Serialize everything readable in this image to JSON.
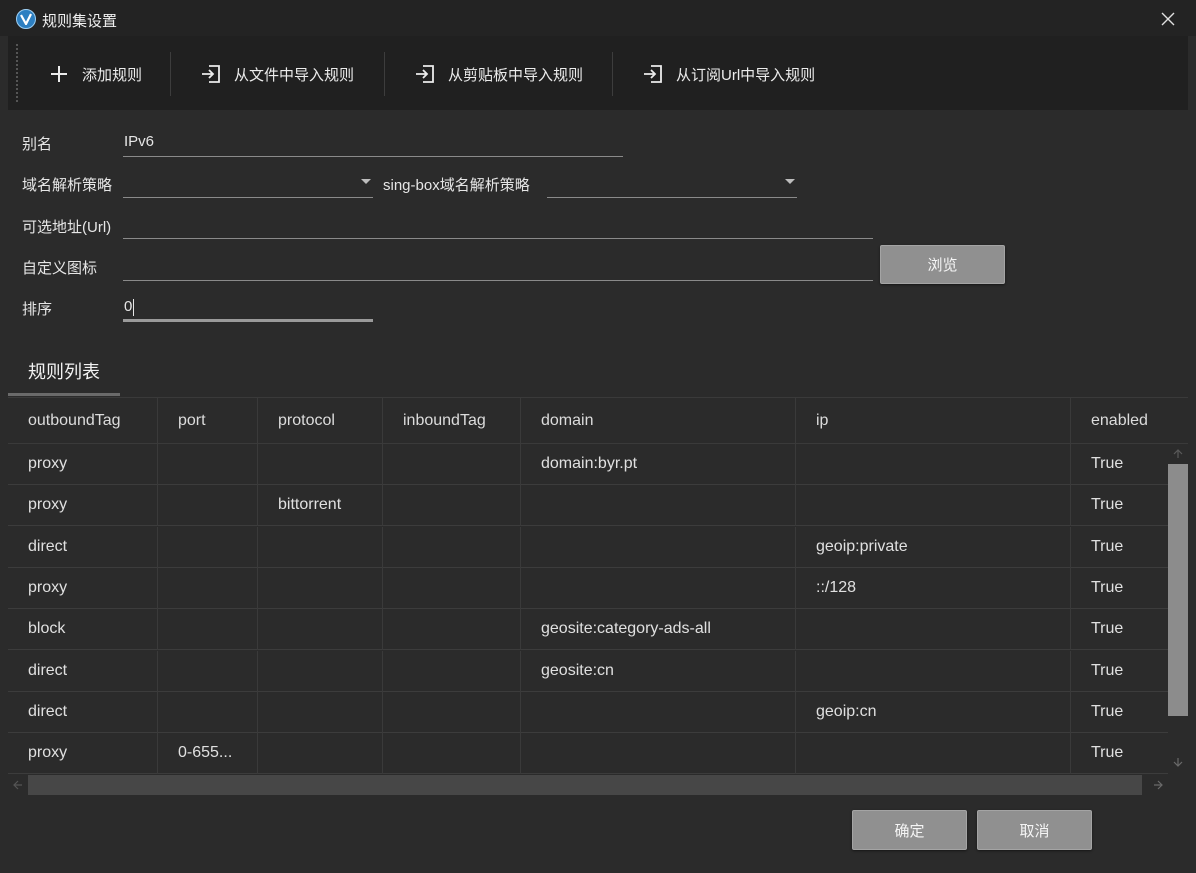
{
  "window": {
    "title": "规则集设置"
  },
  "toolbar": {
    "add_rule": "添加规则",
    "import_file": "从文件中导入规则",
    "import_clipboard": "从剪贴板中导入规则",
    "import_url": "从订阅Url中导入规则"
  },
  "form": {
    "alias_label": "别名",
    "alias_value": "IPv6",
    "domain_strategy_label": "域名解析策略",
    "domain_strategy_value": "",
    "singbox_strategy_label": "sing-box域名解析策略",
    "singbox_strategy_value": "",
    "url_label": "可选地址(Url)",
    "url_value": "",
    "icon_label": "自定义图标",
    "icon_value": "",
    "browse_label": "浏览",
    "sort_label": "排序",
    "sort_value": "0"
  },
  "tab": {
    "label": "规则列表"
  },
  "grid": {
    "columns": [
      "outboundTag",
      "port",
      "protocol",
      "inboundTag",
      "domain",
      "ip",
      "enabled"
    ],
    "rows": [
      [
        "proxy",
        "",
        "",
        "",
        "domain:byr.pt",
        "",
        "True"
      ],
      [
        "proxy",
        "",
        "bittorrent",
        "",
        "",
        "",
        "True"
      ],
      [
        "direct",
        "",
        "",
        "",
        "",
        "geoip:private",
        "True"
      ],
      [
        "proxy",
        "",
        "",
        "",
        "",
        "::/128",
        "True"
      ],
      [
        "block",
        "",
        "",
        "",
        "geosite:category-ads-all",
        "",
        "True"
      ],
      [
        "direct",
        "",
        "",
        "",
        "geosite:cn",
        "",
        "True"
      ],
      [
        "direct",
        "",
        "",
        "",
        "",
        "geoip:cn",
        "True"
      ],
      [
        "proxy",
        "0-655...",
        "",
        "",
        "",
        "",
        "True"
      ]
    ]
  },
  "footer": {
    "ok_label": "确定",
    "cancel_label": "取消"
  },
  "colors": {
    "background": "#2b2b2b",
    "toolbar": "#202020",
    "button": "#909090",
    "app_icon": "#2d7fc1"
  }
}
